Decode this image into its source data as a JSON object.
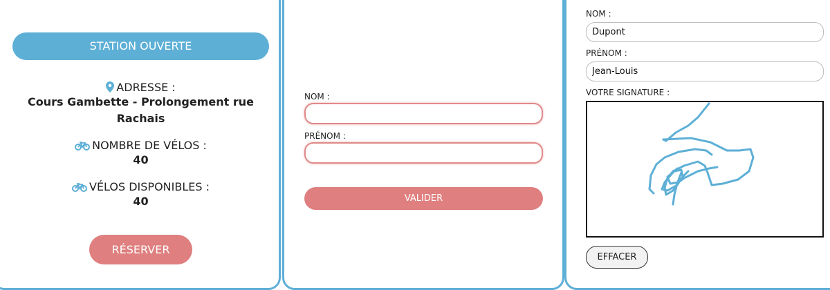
{
  "station": {
    "status": "STATION OUVERTE",
    "address_label": "ADRESSE :",
    "address_value": "Cours Gambette - Prolongement rue Rachais",
    "bikes_label": "NOMBRE DE VÉLOS :",
    "bikes_value": "40",
    "available_label": "VÉLOS DISPONIBLES :",
    "available_value": "40",
    "reserve_label": "RÉSERVER"
  },
  "form": {
    "nom_label": "NOM :",
    "nom_value": "",
    "prenom_label": "PRÉNOM :",
    "prenom_value": "",
    "submit_label": "VALIDER"
  },
  "signature": {
    "nom_label": "NOM :",
    "nom_value": "Dupont",
    "prenom_label": "PRÉNOM :",
    "prenom_value": "Jean-Louis",
    "signature_label": "VOTRE SIGNATURE :",
    "clear_label": "EFFACER"
  },
  "colors": {
    "accent_blue": "#5dafd6",
    "accent_red": "#df7f7f",
    "invalid_border": "#e08a8a"
  },
  "icons": {
    "address": "map-pin-icon",
    "bikes": "bicycle-icon",
    "available": "bicycle-icon"
  }
}
